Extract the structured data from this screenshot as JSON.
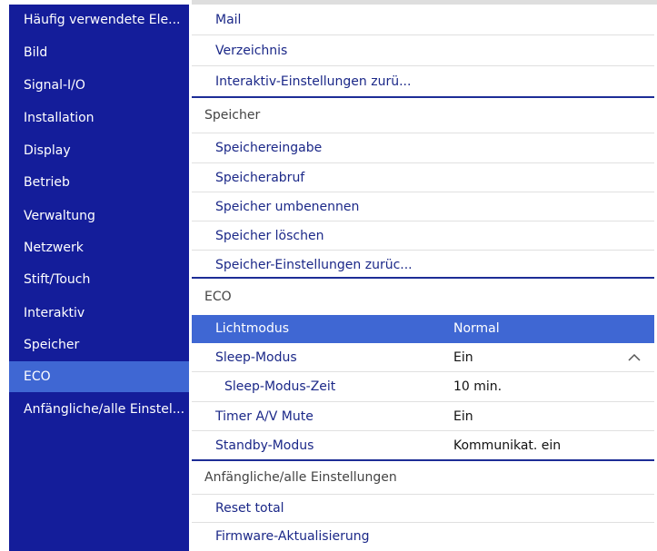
{
  "sidebar": {
    "items": [
      {
        "label": "Häufig verwendete Ele..."
      },
      {
        "label": "Bild"
      },
      {
        "label": "Signal-I/O"
      },
      {
        "label": "Installation"
      },
      {
        "label": "Display"
      },
      {
        "label": "Betrieb"
      },
      {
        "label": "Verwaltung"
      },
      {
        "label": "Netzwerk"
      },
      {
        "label": "Stift/Touch"
      },
      {
        "label": "Interaktiv"
      },
      {
        "label": "Speicher"
      },
      {
        "label": "ECO"
      },
      {
        "label": "Anfängliche/alle Einstel..."
      }
    ],
    "active": "ECO"
  },
  "content": {
    "interaktiv_items": [
      {
        "label": "Mail"
      },
      {
        "label": "Verzeichnis"
      },
      {
        "label": "Interaktiv-Einstellungen zurü..."
      }
    ],
    "speicher": {
      "header": "Speicher",
      "items": [
        {
          "label": "Speichereingabe"
        },
        {
          "label": "Speicherabruf"
        },
        {
          "label": "Speicher umbenennen"
        },
        {
          "label": "Speicher löschen"
        },
        {
          "label": "Speicher-Einstellungen zurüc..."
        }
      ]
    },
    "eco": {
      "header": "ECO",
      "items": [
        {
          "label": "Lichtmodus",
          "value": "Normal"
        },
        {
          "label": "Sleep-Modus",
          "value": "Ein"
        },
        {
          "label": "Sleep-Modus-Zeit",
          "value": "10 min."
        },
        {
          "label": "Timer A/V Mute",
          "value": "Ein"
        },
        {
          "label": "Standby-Modus",
          "value": "Kommunikat. ein"
        }
      ]
    },
    "anfaengliche": {
      "header": "Anfängliche/alle Einstellungen",
      "items": [
        {
          "label": "Reset total"
        },
        {
          "label": "Firmware-Aktualisierung"
        }
      ]
    }
  },
  "icons": {
    "collapse": "chevron-up-icon"
  },
  "colors": {
    "sidebar": "#141d9a",
    "highlight": "#3f67d3",
    "label_text": "#1b2888"
  }
}
